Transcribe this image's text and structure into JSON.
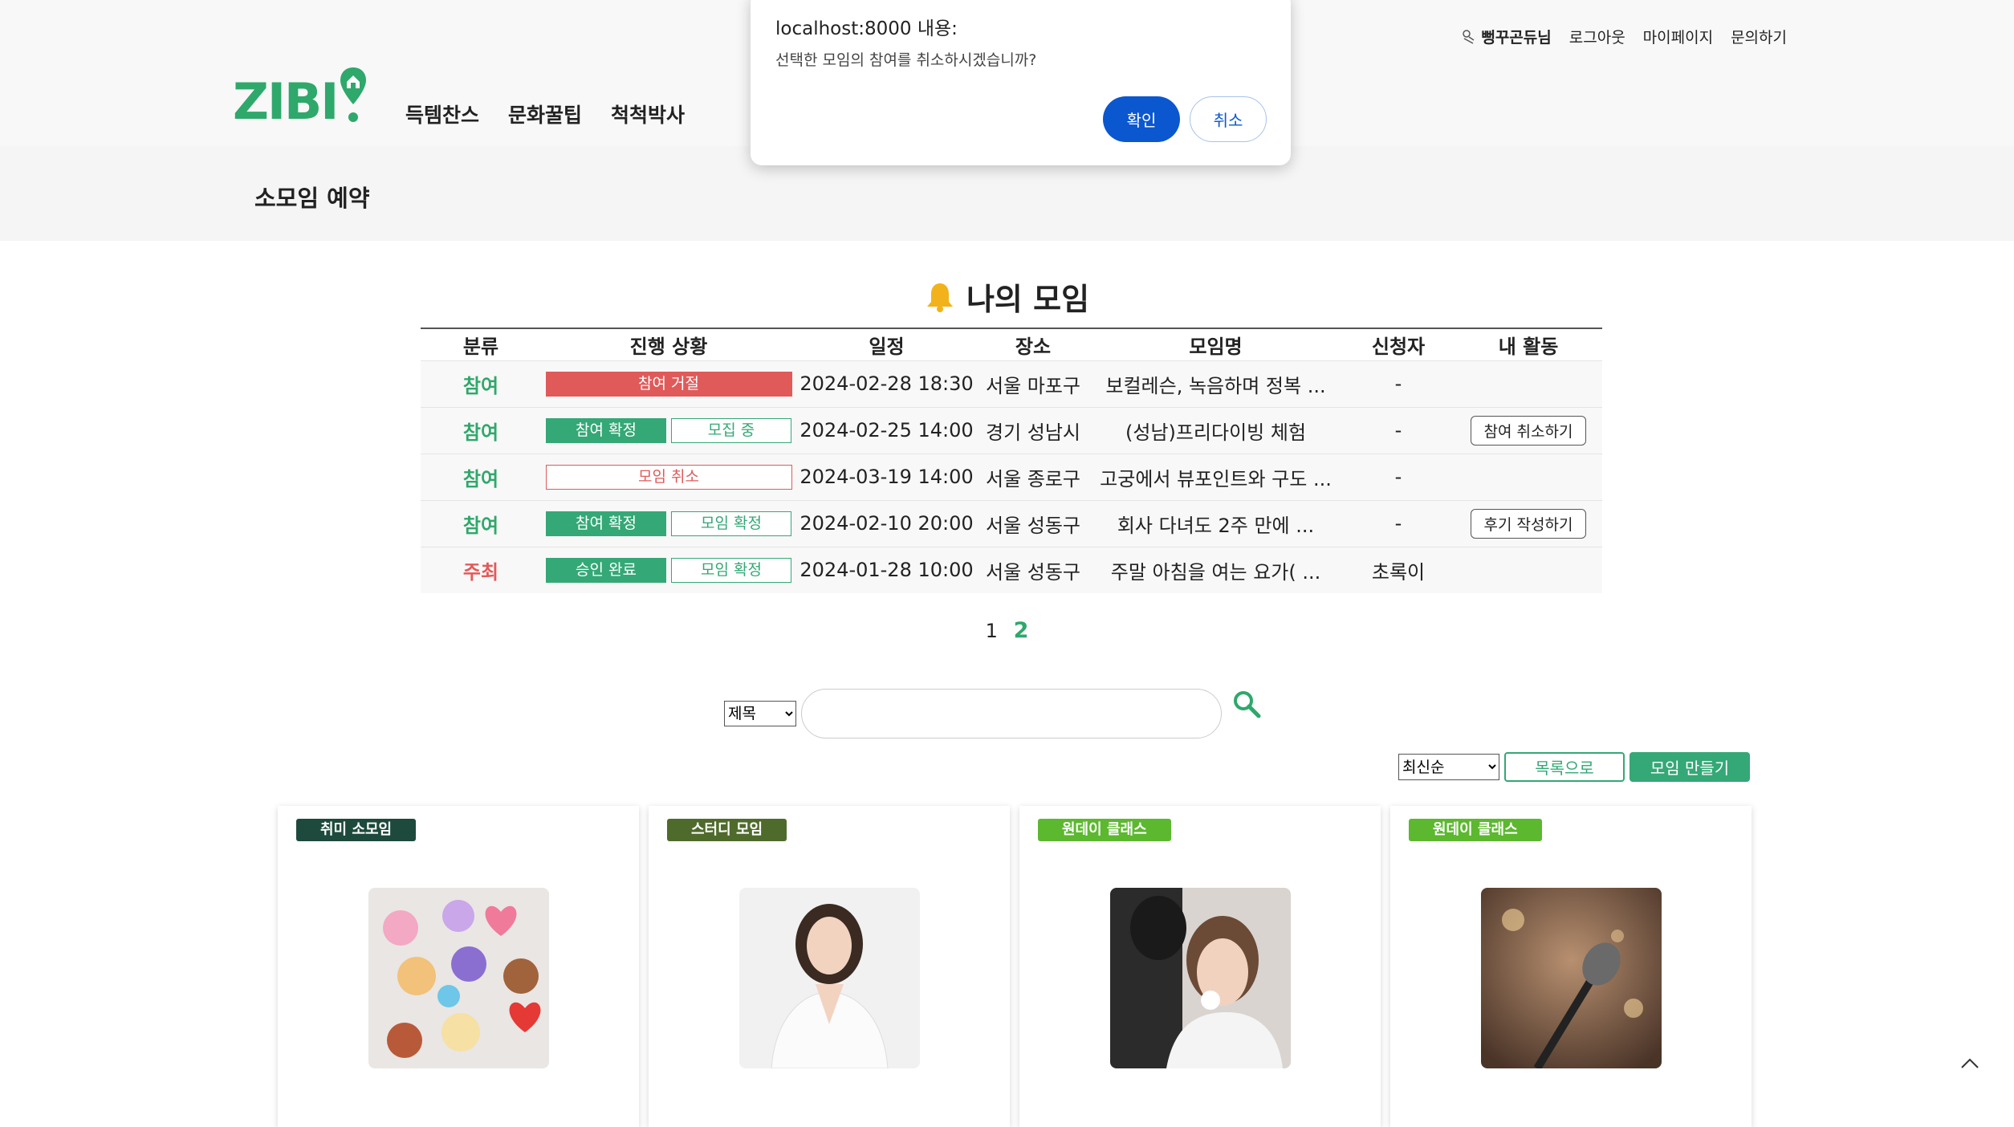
{
  "header": {
    "util": {
      "user": "뻥꾸곤듀님",
      "logout": "로그아웃",
      "mypage": "마이페이지",
      "contact": "문의하기"
    },
    "logo": "ZIBI",
    "nav": [
      "득템찬스",
      "문화꿀팁",
      "척척박사"
    ]
  },
  "subheader": {
    "title": "소모임 예약"
  },
  "my_meetings": {
    "title": "나의 모임",
    "columns": [
      "분류",
      "진행 상황",
      "일정",
      "장소",
      "모임명",
      "신청자",
      "내 활동"
    ],
    "rows": [
      {
        "category": "참여",
        "status": [
          "참여 거절"
        ],
        "date": "2024-02-28 18:30",
        "place": "서울 마포구",
        "name": "보컬레슨, 녹음하며 정복 ...",
        "applicant": "-",
        "action": ""
      },
      {
        "category": "참여",
        "status": [
          "참여 확정",
          "모집 중"
        ],
        "date": "2024-02-25 14:00",
        "place": "경기 성남시",
        "name": "(성남)프리다이빙 체험",
        "applicant": "-",
        "action": "참여 취소하기"
      },
      {
        "category": "참여",
        "status": [
          "모임 취소"
        ],
        "date": "2024-03-19 14:00",
        "place": "서울 종로구",
        "name": "고궁에서 뷰포인트와 구도 ...",
        "applicant": "-",
        "action": ""
      },
      {
        "category": "참여",
        "status": [
          "참여 확정",
          "모임 확정"
        ],
        "date": "2024-02-10 20:00",
        "place": "서울 성동구",
        "name": "회사 다녀도 2주 만에 ...",
        "applicant": "-",
        "action": "후기 작성하기"
      },
      {
        "category": "주최",
        "status": [
          "승인 완료",
          "모임 확정"
        ],
        "date": "2024-01-28 10:00",
        "place": "서울 성동구",
        "name": "주말 아침을 여는 요가( ...",
        "applicant": "초록이",
        "action": ""
      }
    ]
  },
  "pagination": {
    "pages": [
      "1",
      "2"
    ],
    "current": "2"
  },
  "search": {
    "field": "제목",
    "value": ""
  },
  "toolbar": {
    "sort": "최신순",
    "list_btn": "목록으로",
    "create_btn": "모임 만들기"
  },
  "cards": [
    {
      "tag": "취미 소모임",
      "tag_color": "#1d4a3c"
    },
    {
      "tag": "스터디 모임",
      "tag_color": "#4f6b2c"
    },
    {
      "tag": "원데이 클래스",
      "tag_color": "#5cb82f"
    },
    {
      "tag": "원데이 클래스",
      "tag_color": "#5cb82f"
    }
  ],
  "dialog": {
    "origin": "localhost:8000 내용:",
    "message": "선택한 모임의 참여를 취소하시겠습니까?",
    "ok": "확인",
    "cancel": "취소"
  },
  "colors": {
    "brand": "#2fa86b",
    "danger": "#e05a5a",
    "dialog_primary": "#0b57d0"
  }
}
